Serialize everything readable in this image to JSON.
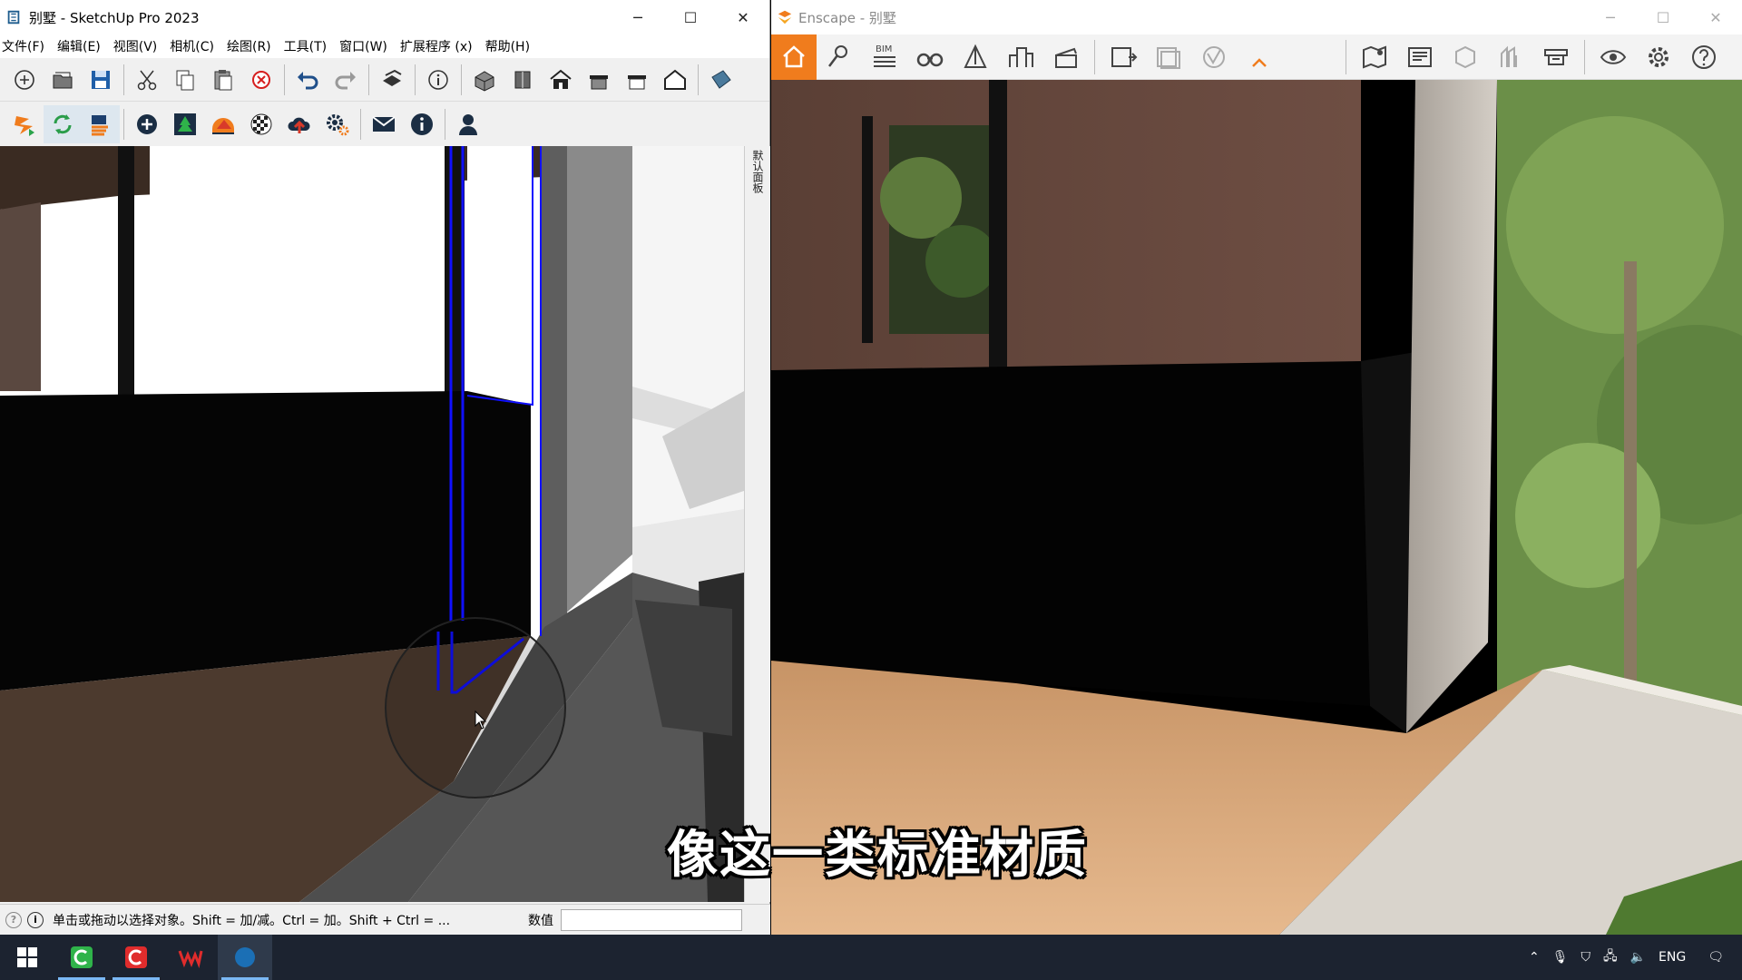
{
  "sketchup": {
    "title": "别墅 - SketchUp Pro 2023",
    "menu": [
      "文件(F)",
      "编辑(E)",
      "视图(V)",
      "相机(C)",
      "绘图(R)",
      "工具(T)",
      "窗口(W)",
      "扩展程序 (x)",
      "帮助(H)"
    ],
    "toolbar1_icons": [
      "new-icon",
      "open-icon",
      "save-icon",
      "cut-icon",
      "copy-icon",
      "paste-icon",
      "erase-icon",
      "undo-icon",
      "redo-icon",
      "print-icon",
      "model-info-icon",
      "iso-view-icon",
      "top-view-icon",
      "front-view-icon",
      "right-view-icon",
      "back-view-icon",
      "left-view-icon",
      "warehouse-icon"
    ],
    "toolbar2_icons": [
      "enscape-start-icon",
      "live-update-icon",
      "sync-views-icon",
      "add-asset-icon",
      "asset-library-icon",
      "visual-settings-icon",
      "material-editor-icon",
      "upload-icon",
      "settings-icon",
      "feedback-icon",
      "about-icon",
      "account-icon"
    ],
    "panel_label": "默认面板",
    "status_text": "单击或拖动以选择对象。Shift = 加/减。Ctrl = 加。Shift + Ctrl = ...",
    "measure_label": "数值",
    "measure_value": ""
  },
  "enscape": {
    "title": "Enscape - 别墅",
    "toolbar_icons": [
      "home-icon",
      "views-icon",
      "bim-icon",
      "binoculars-icon",
      "view-management-icon",
      "site-context-icon",
      "video-editor-icon",
      "render-icon",
      "batch-render-icon",
      "web-standalone-icon",
      "collapse-icon",
      "map-icon",
      "info-panel-icon",
      "section-icon",
      "people-icon",
      "asset-icon",
      "visibility-icon",
      "settings-icon",
      "help-icon"
    ],
    "bim_label": "BIM",
    "accent": "#f07c1d"
  },
  "subtitle": "像这一类标准材质",
  "taskbar": {
    "apps": [
      "start-icon",
      "camtasia-icon",
      "camtasia-recorder-icon",
      "wps-icon",
      "sketchup-icon"
    ],
    "tray_lang": "ENG"
  }
}
